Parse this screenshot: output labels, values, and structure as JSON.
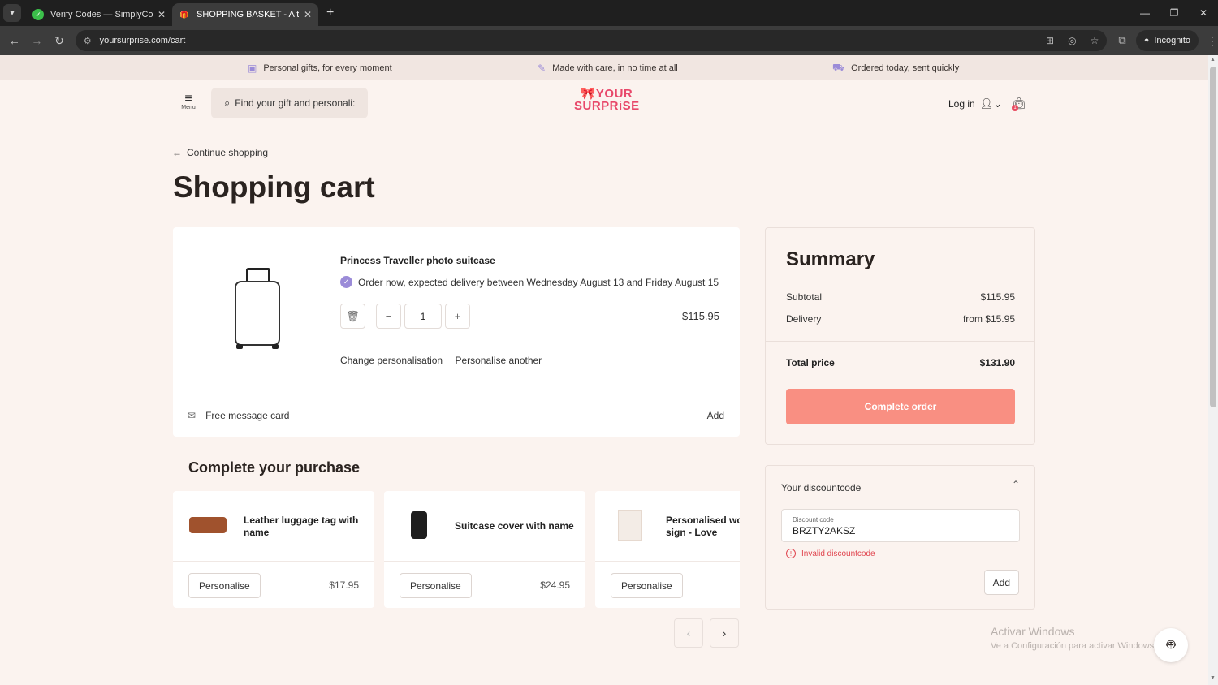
{
  "browser": {
    "tabs": [
      {
        "title": "Verify Codes — SimplyCodes",
        "icon": "check-circle-icon",
        "active": false
      },
      {
        "title": "SHOPPING BASKET - A truly orig",
        "icon": "gift-icon",
        "active": true
      }
    ],
    "url": "yoursurprise.com/cart",
    "incognito_label": "Incógnito"
  },
  "usp_bar": [
    {
      "icon": "gift-box-icon",
      "text": "Personal gifts, for every moment"
    },
    {
      "icon": "pencil-icon",
      "text": "Made with care, in no time at all"
    },
    {
      "icon": "truck-icon",
      "text": "Ordered today, sent quickly"
    }
  ],
  "header": {
    "menu_label": "Menu",
    "search_placeholder": "Find your gift and personali:",
    "logo_line1": "YOUR",
    "logo_line2": "SURPRiSE",
    "login_label": "Log in",
    "cart_count": "1"
  },
  "page": {
    "back_link": "Continue shopping",
    "title": "Shopping cart"
  },
  "cart_item": {
    "name": "Princess Traveller photo suitcase",
    "delivery_text": "Order now, expected delivery between Wednesday August 13 and Friday August 15",
    "quantity": "1",
    "price": "$115.95",
    "change_link": "Change personalisation",
    "another_link": "Personalise another",
    "message_card_label": "Free message card",
    "message_card_action": "Add"
  },
  "upsell": {
    "title": "Complete your purchase",
    "items": [
      {
        "name": "Leather luggage tag with name",
        "button": "Personalise",
        "price": "$17.95"
      },
      {
        "name": "Suitcase cover with name",
        "button": "Personalise",
        "price": "$24.95"
      },
      {
        "name": "Personalised wooden sign - Love",
        "button": "Personalise",
        "price": ""
      }
    ]
  },
  "summary": {
    "title": "Summary",
    "subtotal_label": "Subtotal",
    "subtotal_value": "$115.95",
    "delivery_label": "Delivery",
    "delivery_value": "from $15.95",
    "total_label": "Total price",
    "total_value": "$131.90",
    "cta": "Complete order"
  },
  "discount": {
    "title": "Your discountcode",
    "field_label": "Discount code",
    "field_value": "BRZTY2AKSZ",
    "error": "Invalid discountcode",
    "add_button": "Add"
  },
  "windows_watermark": {
    "line1": "Activar Windows",
    "line2": "Ve a Configuración para activar Windows."
  },
  "colors": {
    "page_bg": "#fbf3ef",
    "brand": "#e8486a",
    "cta": "#f98f82",
    "accent_check": "#9b8bd8",
    "error": "#e0454f"
  }
}
